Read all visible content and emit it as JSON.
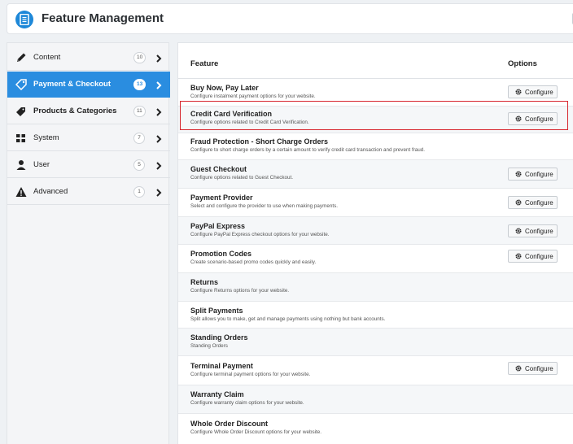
{
  "header": {
    "title": "Feature Management",
    "icon": "document-icon"
  },
  "sidebar": {
    "items": [
      {
        "label": "Content",
        "count": "10",
        "icon": "pencil-icon"
      },
      {
        "label": "Payment & Checkout",
        "count": "13",
        "icon": "tag-icon",
        "active": true
      },
      {
        "label": "Products & Categories",
        "count": "11",
        "icon": "tag-filled-icon"
      },
      {
        "label": "System",
        "count": "7",
        "icon": "grid-icon"
      },
      {
        "label": "User",
        "count": "5",
        "icon": "user-icon"
      },
      {
        "label": "Advanced",
        "count": "1",
        "icon": "warning-icon"
      }
    ]
  },
  "table": {
    "col_feature": "Feature",
    "col_options": "Options",
    "configure_label": "Configure",
    "rows": [
      {
        "name": "Buy Now, Pay Later",
        "desc": "Configure instalment payment options for your website.",
        "configurable": true
      },
      {
        "name": "Credit Card Verification",
        "desc": "Configure options related to Credit Card Verification.",
        "configurable": true,
        "highlighted": true
      },
      {
        "name": "Fraud Protection - Short Charge Orders",
        "desc": "Configure to short charge orders by a certain amount to verify credit card transaction and prevent fraud.",
        "configurable": false
      },
      {
        "name": "Guest Checkout",
        "desc": "Configure options related to Guest Checkout.",
        "configurable": true
      },
      {
        "name": "Payment Provider",
        "desc": "Select and configure the provider to use when making payments.",
        "configurable": true
      },
      {
        "name": "PayPal Express",
        "desc": "Configure PayPal Express checkout options for your website.",
        "configurable": true
      },
      {
        "name": "Promotion Codes",
        "desc": "Create scenario-based promo codes quickly and easily.",
        "configurable": true
      },
      {
        "name": "Returns",
        "desc": "Configure Returns options for your website.",
        "configurable": false
      },
      {
        "name": "Split Payments",
        "desc": "Split allows you to make, get and manage payments using nothing but bank accounts.",
        "configurable": false
      },
      {
        "name": "Standing Orders",
        "desc": "Standing Orders",
        "configurable": false
      },
      {
        "name": "Terminal Payment",
        "desc": "Configure terminal payment options for your website.",
        "configurable": true
      },
      {
        "name": "Warranty Claim",
        "desc": "Configure warranty claim options for your website.",
        "configurable": false
      },
      {
        "name": "Whole Order Discount",
        "desc": "Configure Whole Order Discount options for your website.",
        "configurable": false
      }
    ]
  },
  "colors": {
    "accent": "#2a8de0",
    "highlight": "#d7262e"
  }
}
